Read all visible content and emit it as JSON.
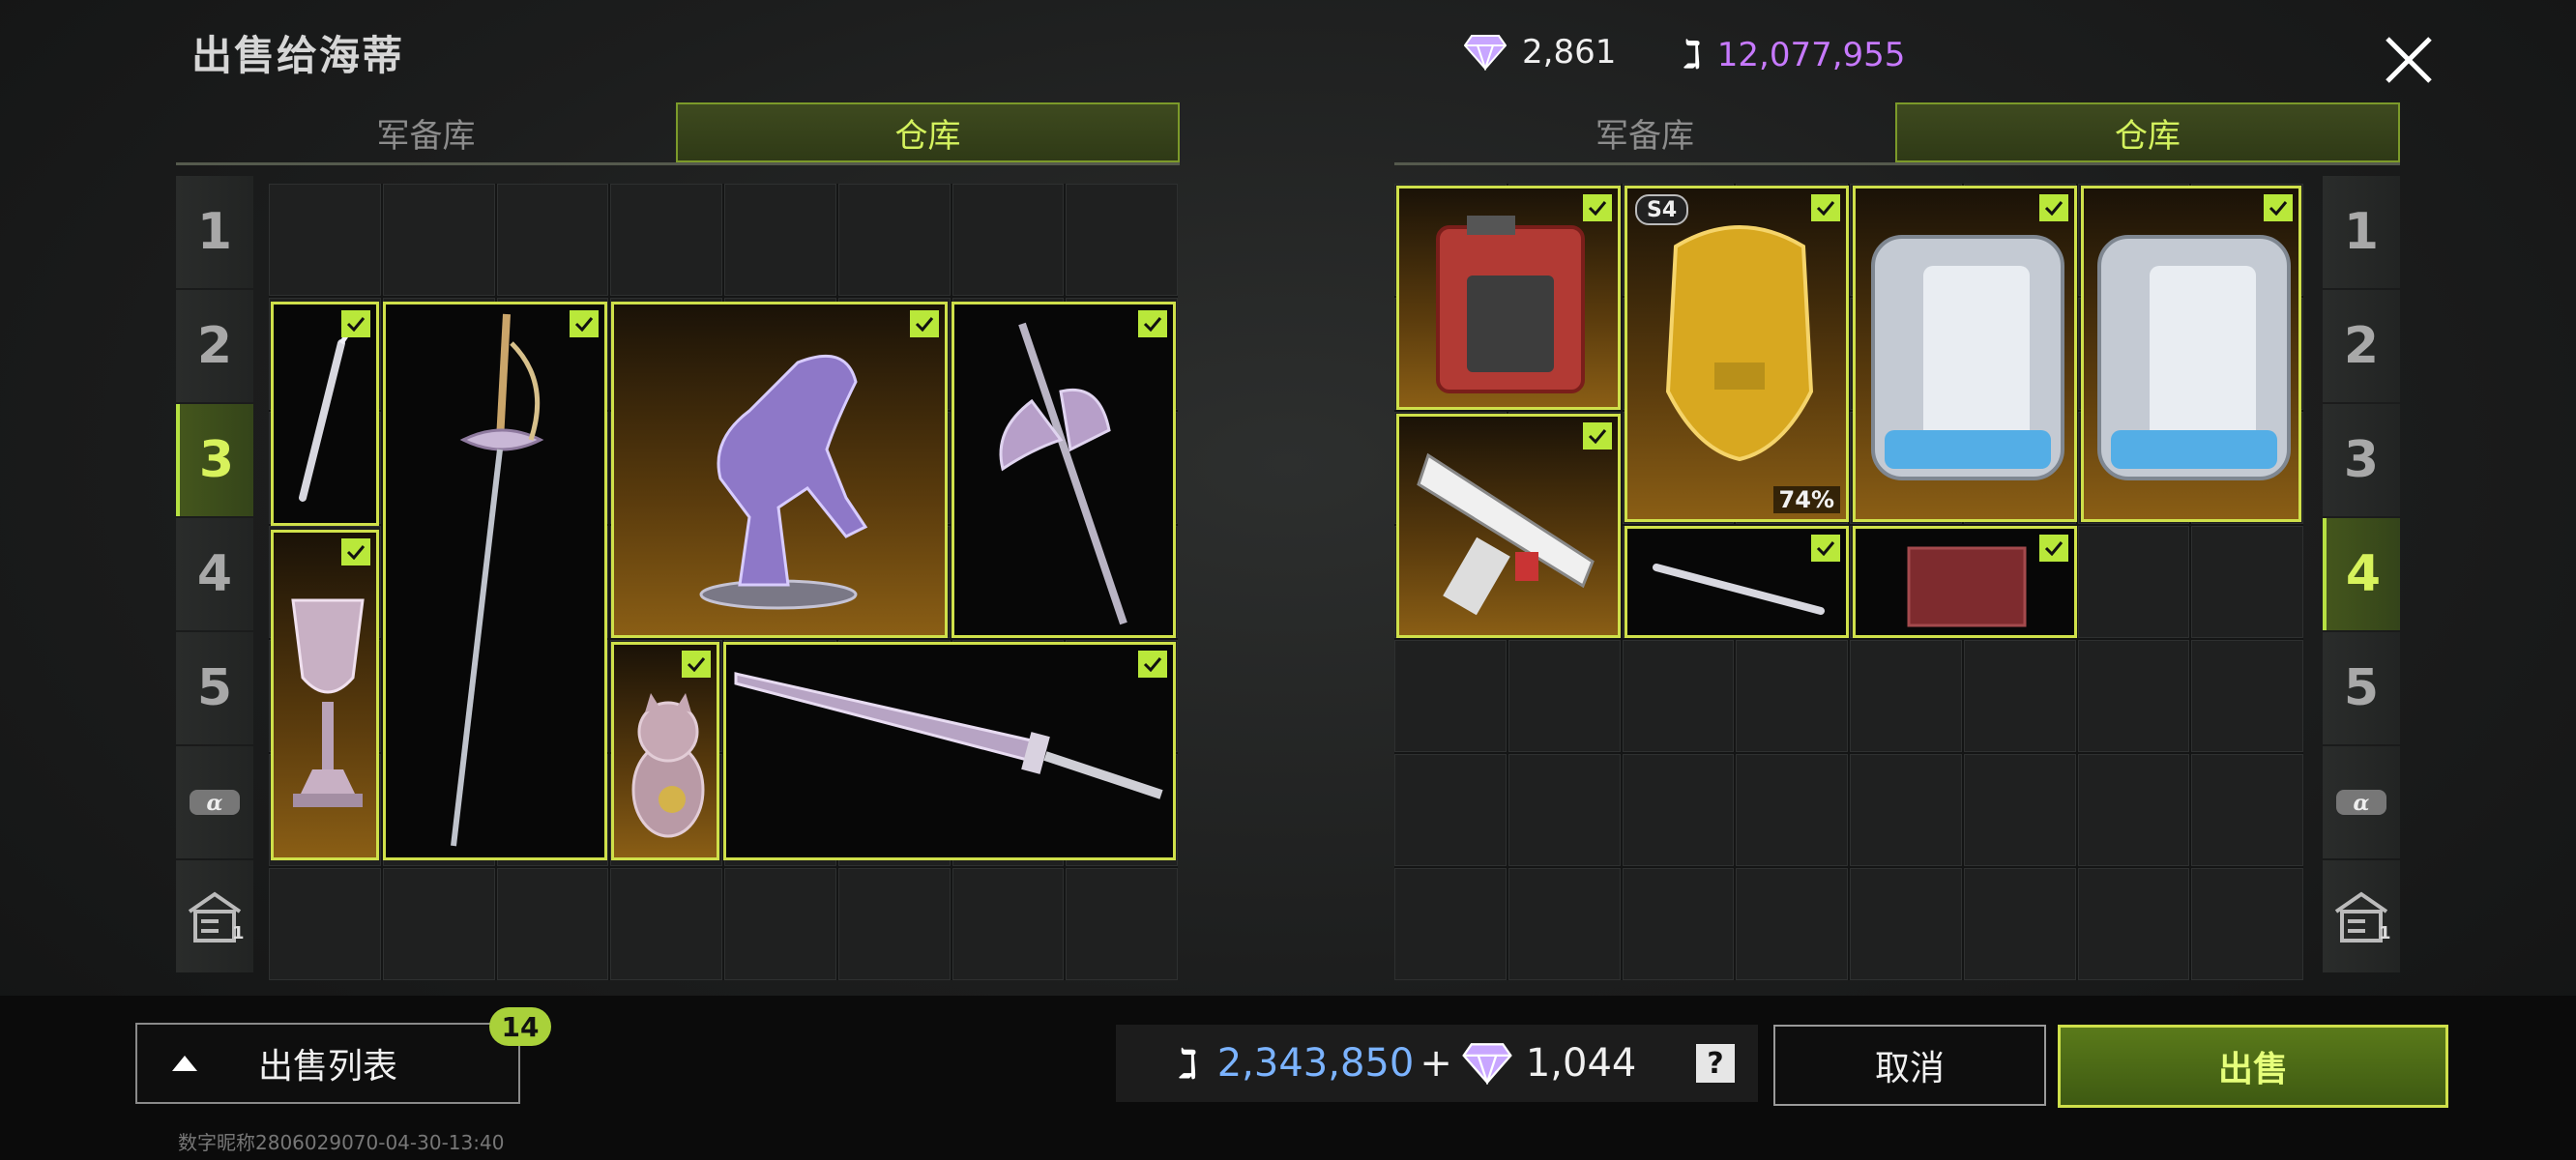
{
  "title": "出售给海蒂",
  "currency": {
    "diamonds": "2,861",
    "coins": "12,077,955"
  },
  "left_panel": {
    "tabs": [
      {
        "label": "军备库"
      },
      {
        "label": "仓库"
      }
    ],
    "active_tab": 1,
    "pages": [
      "1",
      "2",
      "3",
      "4",
      "5"
    ],
    "active_page": "3",
    "items": [
      {
        "name": "scalpel",
        "checked": true
      },
      {
        "name": "rapier",
        "checked": true
      },
      {
        "name": "crystal-horse",
        "checked": true
      },
      {
        "name": "halberd",
        "checked": true
      },
      {
        "name": "trophy-cup",
        "checked": true
      },
      {
        "name": "lucky-cat",
        "checked": true
      },
      {
        "name": "ornate-sword",
        "checked": true
      }
    ]
  },
  "right_panel": {
    "tabs": [
      {
        "label": "军备库"
      },
      {
        "label": "仓库"
      }
    ],
    "active_tab": 1,
    "pages": [
      "1",
      "2",
      "3",
      "4",
      "5"
    ],
    "active_page": "4",
    "items": [
      {
        "name": "fuel-can",
        "checked": true
      },
      {
        "name": "gold-armor",
        "checked": true,
        "badge": "S4",
        "durability": "74%"
      },
      {
        "name": "power-station-1",
        "checked": true
      },
      {
        "name": "power-station-2",
        "checked": true
      },
      {
        "name": "toy-gun",
        "checked": true
      },
      {
        "name": "scalpel-small",
        "checked": true
      },
      {
        "name": "red-box",
        "checked": true
      }
    ]
  },
  "sell_list": {
    "label": "出售列表",
    "count": "14"
  },
  "summary": {
    "coins": "2,343,850",
    "plus": "+",
    "diamonds": "1,044",
    "help": "?"
  },
  "buttons": {
    "cancel": "取消",
    "sell": "出售"
  },
  "footer": "数字昵称2806029070-04-30-13:40",
  "colors": {
    "accent": "#cfe04a",
    "coin_blue": "#7bb3ff",
    "coin_purple": "#c779ff"
  }
}
